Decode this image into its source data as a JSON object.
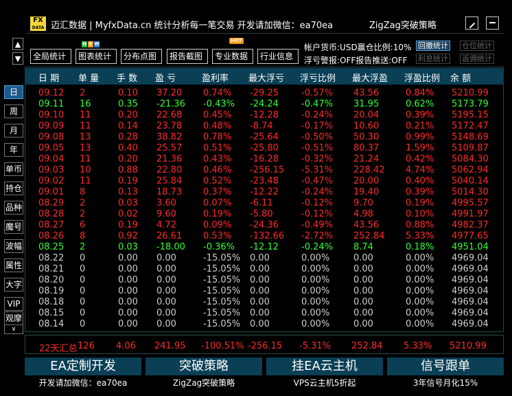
{
  "window": {
    "logo_top": "FX",
    "logo_bottom": "DATA",
    "title": "迈汇数据 | MyfxData.cn  统计分析每一笔交易   开发请加微信：ea70ea",
    "strategy_name": "ZigZag突破策略"
  },
  "toolbar": {
    "buttons": [
      "全局统计",
      "图表统计",
      "分布点图",
      "报告截图",
      "专业数据",
      "行业信息"
    ],
    "new_badge": [
      "N",
      "E",
      "W"
    ],
    "hot_badge": "HOT",
    "info_line1": "帐户货币:USD赢仓比例:10%",
    "info_line2": "浮亏警报:OFF报告推送:OFF",
    "btn_undo": "回撤统计",
    "btn_position": "仓位统计",
    "btn_interest": "利息统计",
    "btn_commission": "返佣统计"
  },
  "side_tabs": [
    "日",
    "周",
    "月",
    "年",
    "单币",
    "持仓",
    "品种",
    "魔号",
    "波幅",
    "属性",
    "大字",
    "VIP",
    "观摩"
  ],
  "columns": [
    "日 期",
    "单 量",
    "手 数",
    "盈 亏",
    "盈利率",
    "最大浮亏",
    "浮亏比例",
    "最大浮盈",
    "浮盈比例",
    "余 额"
  ],
  "rows": [
    {
      "c": "red",
      "v": [
        "09.12",
        "2",
        "0.10",
        "37.20",
        "0.74%",
        "-29.25",
        "-0.57%",
        "43.56",
        "0.84%",
        "5210.99"
      ]
    },
    {
      "c": "green",
      "v": [
        "09.11",
        "16",
        "0.35",
        "-21.36",
        "-0.43%",
        "-24.24",
        "-0.47%",
        "31.95",
        "0.62%",
        "5173.79"
      ]
    },
    {
      "c": "red",
      "v": [
        "09.10",
        "11",
        "0.20",
        "22.68",
        "0.45%",
        "-12.28",
        "-0.24%",
        "20.04",
        "0.39%",
        "5195.15"
      ]
    },
    {
      "c": "red",
      "v": [
        "09.09",
        "11",
        "0.14",
        "23.78",
        "0.48%",
        "-8.74",
        "-0.17%",
        "10.60",
        "0.21%",
        "5172.47"
      ]
    },
    {
      "c": "red",
      "v": [
        "09.08",
        "13",
        "0.28",
        "38.82",
        "0.78%",
        "-25.64",
        "-0.50%",
        "50.30",
        "0.99%",
        "5148.69"
      ]
    },
    {
      "c": "red",
      "v": [
        "09.05",
        "13",
        "0.40",
        "25.57",
        "0.51%",
        "-25.80",
        "-0.51%",
        "80.37",
        "1.59%",
        "5109.87"
      ]
    },
    {
      "c": "red",
      "v": [
        "09.04",
        "11",
        "0.20",
        "21.36",
        "0.43%",
        "-16.28",
        "-0.32%",
        "21.24",
        "0.42%",
        "5084.30"
      ]
    },
    {
      "c": "red",
      "v": [
        "09.03",
        "10",
        "0.88",
        "22.80",
        "0.46%",
        "-256.15",
        "-5.31%",
        "228.42",
        "4.74%",
        "5062.94"
      ]
    },
    {
      "c": "red",
      "v": [
        "09.02",
        "11",
        "0.19",
        "25.84",
        "0.52%",
        "-23.48",
        "-0.47%",
        "20.00",
        "0.40%",
        "5040.14"
      ]
    },
    {
      "c": "red",
      "v": [
        "09.01",
        "8",
        "0.13",
        "18.73",
        "0.37%",
        "-12.22",
        "-0.24%",
        "19.40",
        "0.39%",
        "5014.30"
      ]
    },
    {
      "c": "red",
      "v": [
        "08.29",
        "2",
        "0.03",
        "3.60",
        "0.07%",
        "-6.11",
        "-0.12%",
        "9.70",
        "0.19%",
        "4995.57"
      ]
    },
    {
      "c": "red",
      "v": [
        "08.28",
        "2",
        "0.02",
        "9.60",
        "0.19%",
        "-5.80",
        "-0.12%",
        "4.98",
        "0.10%",
        "4991.97"
      ]
    },
    {
      "c": "red",
      "v": [
        "08.27",
        "6",
        "0.19",
        "4.72",
        "0.09%",
        "-24.36",
        "-0.49%",
        "43.56",
        "0.88%",
        "4982.37"
      ]
    },
    {
      "c": "red",
      "v": [
        "08.26",
        "8",
        "0.92",
        "26.61",
        "0.53%",
        "-132.66",
        "-2.72%",
        "252.84",
        "5.33%",
        "4977.65"
      ]
    },
    {
      "c": "green",
      "v": [
        "08.25",
        "2",
        "0.03",
        "-18.00",
        "-0.36%",
        "-12.12",
        "-0.24%",
        "8.74",
        "0.18%",
        "4951.04"
      ]
    },
    {
      "c": "gray",
      "v": [
        "08.22",
        "0",
        "0.00",
        "0.00",
        "-15.05%",
        "0.00",
        "0.00%",
        "0.00",
        "0.00%",
        "4969.04"
      ]
    },
    {
      "c": "gray",
      "v": [
        "08.21",
        "0",
        "0.00",
        "0.00",
        "-15.05%",
        "0.00",
        "0.00%",
        "0.00",
        "0.00%",
        "4969.04"
      ]
    },
    {
      "c": "gray",
      "v": [
        "08.20",
        "0",
        "0.00",
        "0.00",
        "-15.05%",
        "0.00",
        "0.00%",
        "0.00",
        "0.00%",
        "4969.04"
      ]
    },
    {
      "c": "gray",
      "v": [
        "08.19",
        "0",
        "0.00",
        "0.00",
        "-15.05%",
        "0.00",
        "0.00%",
        "0.00",
        "0.00%",
        "4969.04"
      ]
    },
    {
      "c": "gray",
      "v": [
        "08.18",
        "0",
        "0.00",
        "0.00",
        "-15.05%",
        "0.00",
        "0.00%",
        "0.00",
        "0.00%",
        "4969.04"
      ]
    },
    {
      "c": "gray",
      "v": [
        "08.15",
        "0",
        "0.00",
        "0.00",
        "-15.05%",
        "0.00",
        "0.00%",
        "0.00",
        "0.00%",
        "4969.04"
      ]
    },
    {
      "c": "gray",
      "v": [
        "08.14",
        "0",
        "0.00",
        "0.00",
        "-15.05%",
        "0.00",
        "0.00%",
        "0.00",
        "0.00%",
        "4969.04"
      ]
    }
  ],
  "summary": [
    "22天汇总",
    "126",
    "4.06",
    "241.95",
    "-100.51%",
    "-256.15",
    "-5.31%",
    "252.84",
    "5.33%",
    "5210.99"
  ],
  "ads": [
    {
      "title": "EA定制开发",
      "sub": "开发请加微信：ea70ea"
    },
    {
      "title": "突破策略",
      "sub": "ZigZag突破策略"
    },
    {
      "title": "挂EA云主机",
      "sub": "VPS云主机5折起"
    },
    {
      "title": "信号跟单",
      "sub": "3年信号月化15%"
    }
  ],
  "colors": {
    "red": "#ff2a2a",
    "green": "#33ff33",
    "header_bg": "#0b3f55",
    "active_tab": "#1d5a8a"
  }
}
